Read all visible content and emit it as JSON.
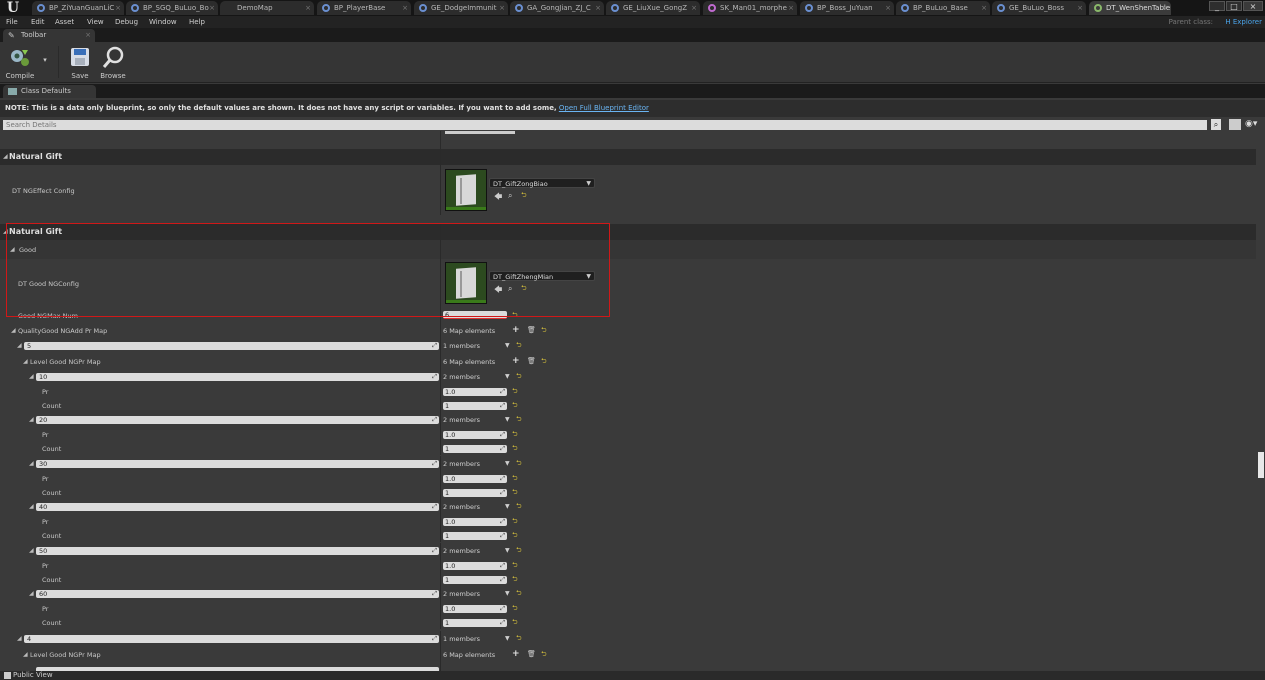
{
  "window": {
    "tabs": [
      {
        "label": "BP_ZiYuanGuanLiC",
        "icon": "blueprint-icon",
        "active": false
      },
      {
        "label": "BP_SGQ_BuLuo_Bo",
        "icon": "blueprint-icon",
        "active": false
      },
      {
        "label": "DemoMap",
        "icon": "",
        "active": false
      },
      {
        "label": "BP_PlayerBase",
        "icon": "blueprint-icon",
        "active": false
      },
      {
        "label": "GE_DodgeImmunit",
        "icon": "blueprint-icon",
        "active": false
      },
      {
        "label": "GA_GongJian_ZJ_C",
        "icon": "blueprint-icon",
        "active": false
      },
      {
        "label": "GE_LiuXue_GongZ",
        "icon": "blueprint-icon",
        "active": false
      },
      {
        "label": "SK_Man01_morphe",
        "icon": "skeleton-icon",
        "active": false
      },
      {
        "label": "BP_Boss_JuYuan",
        "icon": "blueprint-icon",
        "active": false
      },
      {
        "label": "BP_BuLuo_Base",
        "icon": "blueprint-icon",
        "active": false
      },
      {
        "label": "GE_BuLuo_Boss",
        "icon": "blueprint-icon",
        "active": false
      },
      {
        "label": "DT_WenShenTable",
        "icon": "table-icon",
        "active": true
      }
    ],
    "minimize": "_",
    "maximize": "□",
    "close": "×"
  },
  "menubar": {
    "items": [
      "File",
      "Edit",
      "Asset",
      "View",
      "Debug",
      "Window",
      "Help"
    ],
    "parent_class_label": "Parent class:",
    "parent_class_value": "H Explorer"
  },
  "toolbar": {
    "panel_tab": "Toolbar",
    "compile": "Compile",
    "save": "Save",
    "browse": "Browse"
  },
  "class_defaults": {
    "tab": "Class Defaults",
    "note_bold": "NOTE: This is a data only blueprint, so only the default values are shown.  It does not have any script or variables.  If you want to add some,",
    "note_link": "Open Full Blueprint Editor",
    "search_placeholder": "Search Details"
  },
  "details": {
    "cat1_title": "Natural Gift",
    "dt_ngeffect_label": "DT NGEffect Config",
    "dt_ngeffect_value": "DT_GiftZongBiao",
    "cat2_title": "Natural Gift",
    "good_label": "Good",
    "dt_good_label": "DT Good NGConfig",
    "dt_good_value": "DT_GiftZhengMian",
    "max_num_label": "Good NGMax Num",
    "max_num_value": "6",
    "quality_map_label": "QualityGood NGAdd Pr Map",
    "quality_map_value": "6 Map elements",
    "members_1": "1 members",
    "members_2": "2 members",
    "map_elements": "6 Map elements",
    "level_map_label": "Level Good NGPr Map",
    "pr_label": "Pr",
    "count_label": "Count",
    "pr_value": "1.0",
    "count_value": "1",
    "key_5": "5",
    "key_4": "4",
    "level_keys": [
      "10",
      "20",
      "30",
      "40",
      "50",
      "60"
    ]
  },
  "status": {
    "public_view": "Public View"
  }
}
